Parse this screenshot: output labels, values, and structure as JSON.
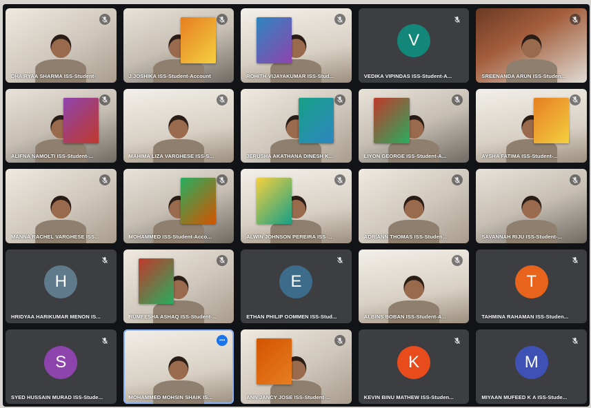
{
  "participants": [
    {
      "name": "DHAIRYAA SHARMA ISS-Student-",
      "type": "video",
      "initial": ""
    },
    {
      "name": "J.JOSHIKA ISS-Student-Account",
      "type": "video",
      "initial": ""
    },
    {
      "name": "ROHITH VIJAYAKUMAR ISS-Stud...",
      "type": "video",
      "initial": ""
    },
    {
      "name": "VEDIKA VIPINDAS ISS-Student-A...",
      "type": "avatar",
      "initial": "V",
      "color": "#12877a"
    },
    {
      "name": "SREENANDA ARUN ISS-Studen...",
      "type": "video",
      "initial": ""
    },
    {
      "name": "ALIFNA NAMOLTI ISS-Student-...",
      "type": "video",
      "initial": ""
    },
    {
      "name": "MAHIMA LIZA VARGHESE ISS-S...",
      "type": "video",
      "initial": ""
    },
    {
      "name": "JERUSHA AKATHANA DINESH K...",
      "type": "video",
      "initial": ""
    },
    {
      "name": "LIYON GEORGE ISS-Student-A...",
      "type": "video",
      "initial": ""
    },
    {
      "name": "AYSHA FATIMA ISS-Student-...",
      "type": "video",
      "initial": ""
    },
    {
      "name": "MANNA RACHEL VARGHESE ISS...",
      "type": "video",
      "initial": ""
    },
    {
      "name": "MOHAMMED ISS-Student-Acco...",
      "type": "video",
      "initial": ""
    },
    {
      "name": "ALWIN JOHNSON PEREIRA ISS-...",
      "type": "video",
      "initial": ""
    },
    {
      "name": "ADRIANN THOMAS ISS-Studen...",
      "type": "video",
      "initial": ""
    },
    {
      "name": "SAVANNAH RIJU ISS-Student-...",
      "type": "video",
      "initial": ""
    },
    {
      "name": "HRIDYAA HARIKUMAR MENON IS...",
      "type": "avatar",
      "initial": "H",
      "color": "#5f7a8a"
    },
    {
      "name": "RUMEESHA ASHAQ ISS-Student-...",
      "type": "video",
      "initial": ""
    },
    {
      "name": "ETHAN PHILIP OOMMEN ISS-Stud...",
      "type": "avatar",
      "initial": "E",
      "color": "#3d6b8a"
    },
    {
      "name": "ALBINS BOBAN ISS-Student-A...",
      "type": "video",
      "initial": ""
    },
    {
      "name": "TAHMINA RAHAMAN ISS-Studen...",
      "type": "avatar",
      "initial": "T",
      "color": "#e8641c"
    },
    {
      "name": "SYED HUSSAIN MURAD ISS-Stude...",
      "type": "avatar",
      "initial": "S",
      "color": "#8e44ad"
    },
    {
      "name": "MOHAMMED MOHSIN SHAIK IS...",
      "type": "video",
      "initial": ""
    },
    {
      "name": "ANN JANCY JOSE ISS-Student-...",
      "type": "video",
      "initial": ""
    },
    {
      "name": "KEVIN BINU MATHEW ISS-Studen...",
      "type": "avatar",
      "initial": "K",
      "color": "#e84b1c"
    },
    {
      "name": "MIYAAN MUFEED K A ISS-Stude...",
      "type": "avatar",
      "initial": "M",
      "color": "#3f51b5"
    }
  ],
  "muted_icon": "mic-off-icon",
  "speaking_icon": "speaking-indicator-icon"
}
